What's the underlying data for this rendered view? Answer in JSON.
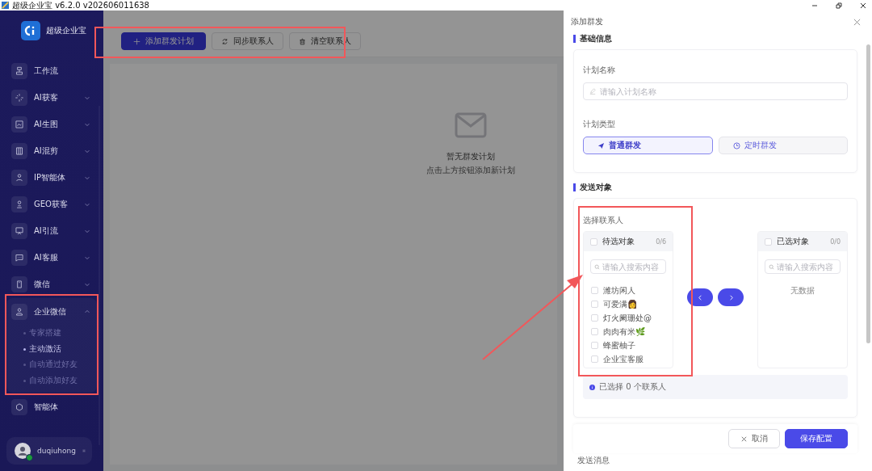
{
  "window": {
    "title": "超级企业宝 v6.2.0 v202606011638"
  },
  "sidebar": {
    "brand": "超级企业宝",
    "items": [
      {
        "label": "工作流",
        "expandable": false,
        "expanded": false
      },
      {
        "label": "AI获客",
        "expandable": true,
        "expanded": false
      },
      {
        "label": "AI生图",
        "expandable": true,
        "expanded": false
      },
      {
        "label": "AI混剪",
        "expandable": true,
        "expanded": false
      },
      {
        "label": "IP智能体",
        "expandable": true,
        "expanded": false
      },
      {
        "label": "GEO获客",
        "expandable": true,
        "expanded": false
      },
      {
        "label": "AI引流",
        "expandable": true,
        "expanded": false
      },
      {
        "label": "AI客服",
        "expandable": true,
        "expanded": false
      },
      {
        "label": "微信",
        "expandable": true,
        "expanded": false
      },
      {
        "label": "企业微信",
        "expandable": true,
        "expanded": true,
        "children": [
          {
            "label": "专家搭建",
            "selected": false
          },
          {
            "label": "主动激活",
            "selected": true
          },
          {
            "label": "自动通过好友",
            "selected": false
          },
          {
            "label": "自动添加好友",
            "selected": false
          }
        ]
      },
      {
        "label": "智能体",
        "expandable": false,
        "expanded": false
      }
    ],
    "user": {
      "name": "duqiuhong",
      "online": true
    }
  },
  "toolbar": [
    {
      "label": "添加群发计划",
      "kind": "primary"
    },
    {
      "label": "同步联系人",
      "kind": "sync"
    },
    {
      "label": "清空联系人",
      "kind": "clear"
    }
  ],
  "empty_state": {
    "title": "暂无群发计划",
    "hint": "点击上方按钮添加新计划"
  },
  "drawer": {
    "title": "添加群发",
    "basic": {
      "heading": "基础信息",
      "name_label": "计划名称",
      "name_placeholder": "请输入计划名称",
      "type_label": "计划类型",
      "types": [
        {
          "label": "普通群发",
          "selected": true
        },
        {
          "label": "定时群发",
          "selected": false
        }
      ]
    },
    "target": {
      "heading": "发送对象",
      "label": "选择联系人",
      "left": {
        "title": "待选对象",
        "count": "0/6",
        "checked": false,
        "placeholder": "请输入搜索内容",
        "items": [
          {
            "label": "潍坊闲人",
            "checked": false
          },
          {
            "label": "可爱满👩",
            "checked": false
          },
          {
            "label": "灯火阑珊处@",
            "checked": false
          },
          {
            "label": "肉肉有米🌿",
            "checked": false
          },
          {
            "label": "蜂蜜柚子",
            "checked": false
          },
          {
            "label": "企业宝客服",
            "checked": false
          }
        ]
      },
      "right": {
        "title": "已选对象",
        "count": "0/0",
        "checked": false,
        "placeholder": "请输入搜索内容",
        "empty": "无数据"
      },
      "summary": "已选择 0 个联系人"
    },
    "buttons": [
      {
        "label": "取消",
        "kind": "cancel"
      },
      {
        "label": "保存配置",
        "kind": "primary"
      }
    ],
    "next_heading": "发送消息"
  }
}
